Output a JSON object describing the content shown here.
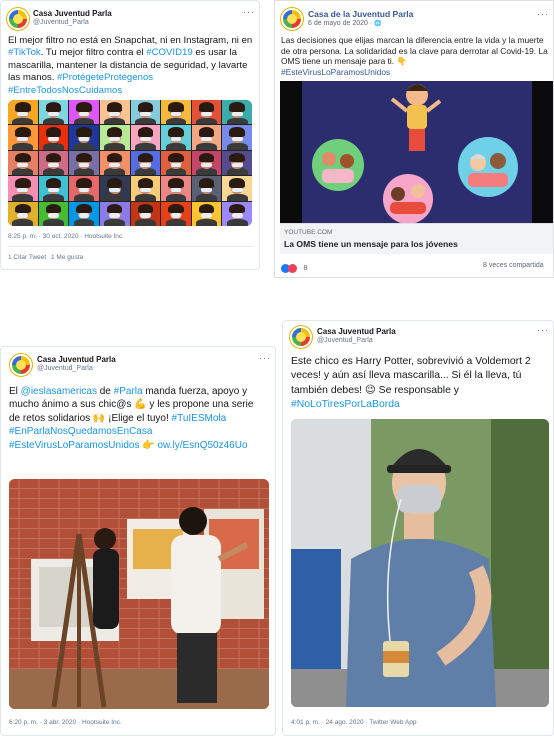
{
  "tweet1": {
    "name": "Casa Juventud Parla",
    "handle": "@Juventud_Parla",
    "menu": "···",
    "text": [
      {
        "t": "El mejor filtro no está en Snapchat, ni en Instagram, ni en "
      },
      {
        "t": "#TikTok",
        "h": true
      },
      {
        "t": ". Tu mejor filtro contra el "
      },
      {
        "t": "#COVID19",
        "h": true
      },
      {
        "t": " es usar la mascarilla, mantener la distancia de seguridad, y lavarte las manos. "
      },
      {
        "t": "#ProtégeteProtégenos",
        "h": true
      },
      {
        "t": " "
      },
      {
        "t": "#EntreTodosNosCuidamos",
        "h": true
      }
    ],
    "meta": "8:25 p. m. · 30 oct. 2020 · Hootsuite Inc.",
    "retweets": "1 Citar Tweet",
    "likes": "1 Me gusta",
    "image_alt": "Cuadrícula de jóvenes con mascarilla sobre fondos de colores",
    "tile_colors": [
      "#f5a623",
      "#7ed6df",
      "#e056fd",
      "#f8c291",
      "#82ccdd",
      "#f6b93b",
      "#e55039",
      "#38ada9",
      "#fa983a",
      "#eb2f06",
      "#1e3799",
      "#b8e994",
      "#f8a5c2",
      "#63cdda",
      "#f3a683",
      "#778beb",
      "#e77f67",
      "#cf6a87",
      "#786fa6",
      "#f19066",
      "#546de5",
      "#e15f41",
      "#c44569",
      "#574b90",
      "#f78fb3",
      "#3dc1d3",
      "#e66767",
      "#303952",
      "#f5cd79",
      "#ea8685",
      "#596275",
      "#f7d794",
      "#e1b12c",
      "#44bd32",
      "#0097e6",
      "#8c7ae6",
      "#c23616",
      "#e84118",
      "#fbc531",
      "#9c88ff"
    ]
  },
  "fbpost": {
    "name": "Casa de la Juventud Parla",
    "date": "6 de mayo de 2020 · ",
    "globe": "🌐",
    "menu": "···",
    "text": [
      {
        "t": "Las decisiones que elijas marcan la diferencia entre la vida y la muerte de otra persona. La solidaridad es la clave para derrotar al Covid-19. La OMS tiene un mensaje para ti. 👇"
      },
      {
        "t": "#EsteVirusLoParamosUnidos",
        "h": true
      }
    ],
    "link_source": "YOUTUBE.COM",
    "link_title": "La OMS tiene un mensaje para los jóvenes",
    "reactions_count": "8",
    "shares": "8 veces compartida",
    "image_alt": "Ilustración animada de jóvenes y personas mayores"
  },
  "tweet2": {
    "name": "Casa Juventud Parla",
    "handle": "@Juventud_Parla",
    "menu": "···",
    "text": [
      {
        "t": "El "
      },
      {
        "t": "@ieslasamericas",
        "h": true
      },
      {
        "t": " de "
      },
      {
        "t": "#Parla",
        "h": true
      },
      {
        "t": " manda fuerza, apoyo y mucho ánimo a sus chic@s 💪 y les propone una serie de retos solidarios 🙌 ¡Elige el tuyo! "
      },
      {
        "t": "#TuIESMola",
        "h": true
      },
      {
        "t": " "
      },
      {
        "t": "#EnParlaNosQuedamosEnCasa",
        "h": true
      },
      {
        "t": " "
      },
      {
        "t": "#EsteVirusLoParamosUnidos",
        "h": true
      },
      {
        "t": " 👉 "
      },
      {
        "t": "ow.ly/EsnQ50z46Uo",
        "h": true
      }
    ],
    "meta": "6:20 p. m. · 3 abr. 2020 · Hootsuite Inc.",
    "image_alt": "Estudiantes pintando en caballetes en un pasillo de ladrillo"
  },
  "tweet3": {
    "name": "Casa Juventud Parla",
    "handle": "@Juventud_Parla",
    "menu": "···",
    "text": [
      {
        "t": "Este chico es Harry Potter, sobrevivió a Voldemort 2 veces! y aún así lleva mascarilla... Si él la lleva, tú también debes! 😉 Se responsable y "
      },
      {
        "t": "#NoLoTiresPorLaBorda",
        "h": true
      }
    ],
    "meta": "4:01 p. m. · 24 ago. 2020 · Twitter Web App",
    "image_alt": "Joven con gorra y mascarilla llevando un vaso de café"
  },
  "colors": {
    "link": "#1b95e0",
    "fb_blue": "#385898",
    "like_blue": "#2078f4",
    "love_red": "#f33e58"
  }
}
